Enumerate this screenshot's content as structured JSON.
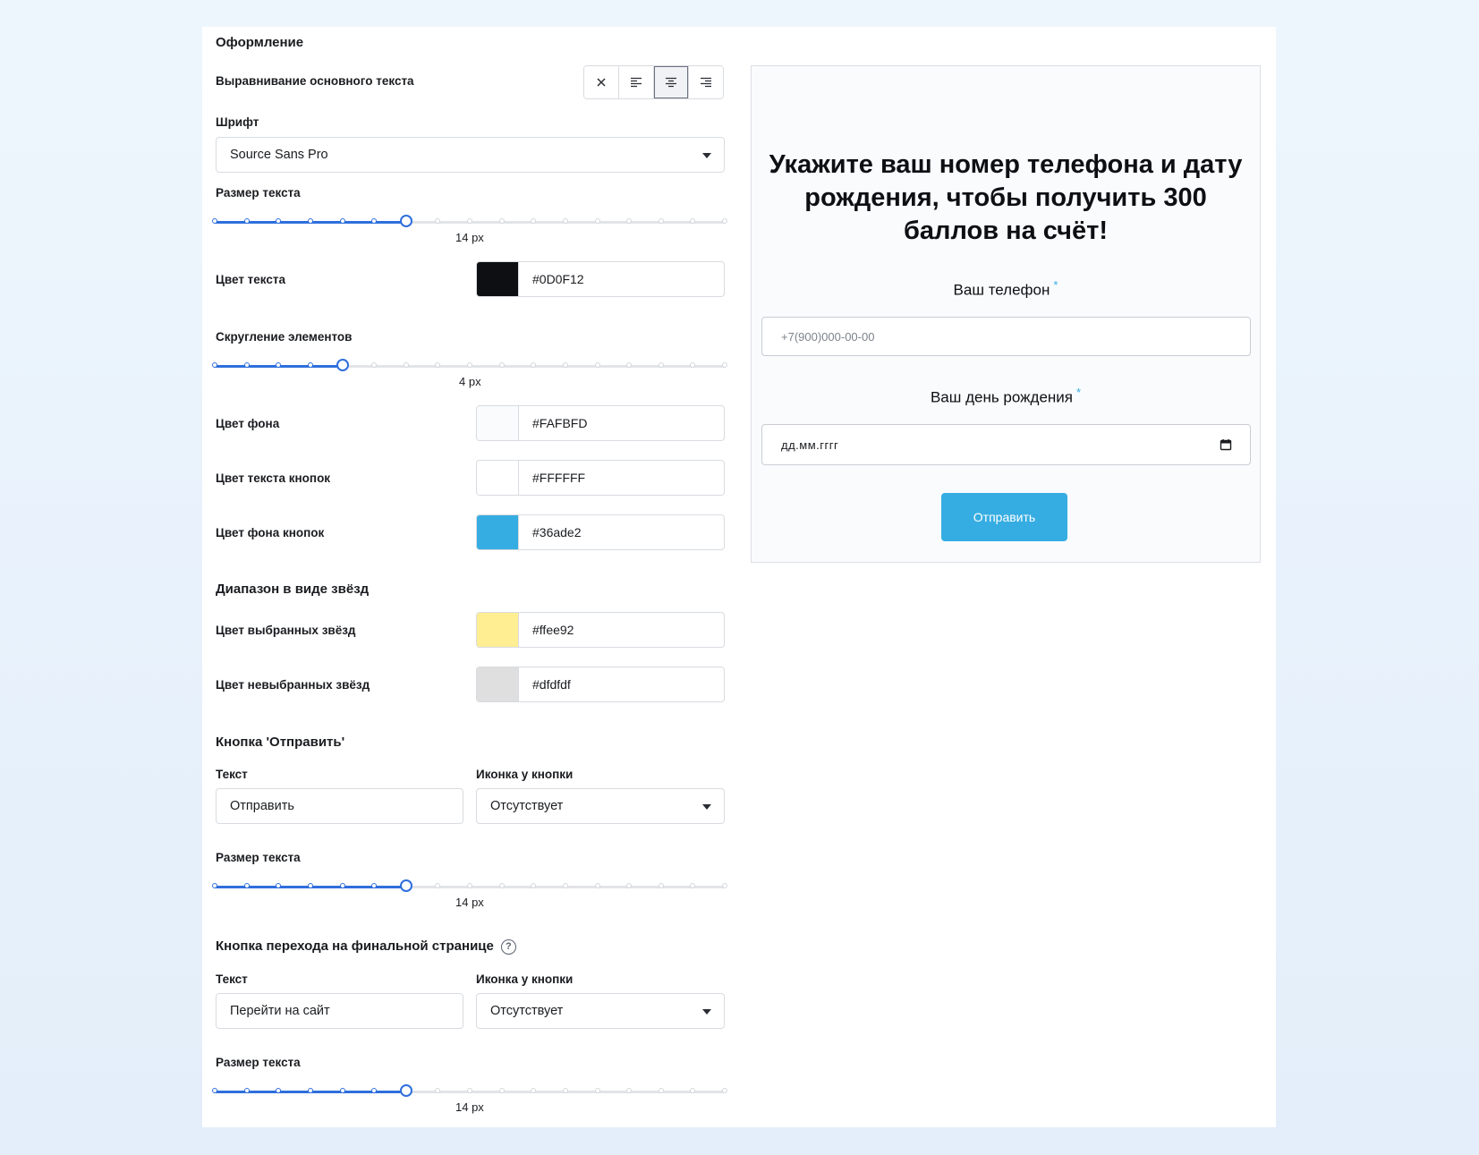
{
  "design": {
    "section_title": "Оформление",
    "alignment_label": "Выравнивание основного текста",
    "font_label": "Шрифт",
    "font_value": "Source Sans Pro",
    "text_size_label": "Размер текста",
    "text_size_value": "14 px",
    "text_size_level": 6,
    "text_color_label": "Цвет текста",
    "text_color_value": "#0D0F12",
    "radius_label": "Скругление элементов",
    "radius_value": "4 px",
    "radius_level": 4,
    "bg_color_label": "Цвет фона",
    "bg_color_value": "#FAFBFD",
    "btn_text_color_label": "Цвет текста кнопок",
    "btn_text_color_value": "#FFFFFF",
    "btn_bg_color_label": "Цвет фона кнопок",
    "btn_bg_color_value": "#36ade2"
  },
  "stars": {
    "section_title": "Диапазон в виде звёзд",
    "selected_label": "Цвет выбранных звёзд",
    "selected_value": "#ffee92",
    "unselected_label": "Цвет невыбранных звёзд",
    "unselected_value": "#dfdfdf"
  },
  "submit_button": {
    "section_title": "Кнопка 'Отправить'",
    "text_label": "Текст",
    "text_value": "Отправить",
    "icon_label": "Иконка у кнопки",
    "icon_value": "Отсутствует",
    "size_label": "Размер текста",
    "size_value": "14 px",
    "size_level": 6
  },
  "final_button": {
    "section_title": "Кнопка перехода на финальной странице",
    "help": "?",
    "text_label": "Текст",
    "text_value": "Перейти на сайт",
    "icon_label": "Иконка у кнопки",
    "icon_value": "Отсутствует",
    "size_label": "Размер текста",
    "size_value": "14 px",
    "size_level": 6
  },
  "slider_steps": 16,
  "colors": {
    "accent": "#2f6fdc",
    "text": "#0D0F12",
    "background": "#FAFBFD",
    "button_bg": "#36ade2",
    "star_selected": "#ffee92",
    "star_unselected": "#dfdfdf"
  },
  "preview": {
    "title": "Укажите ваш номер телефона и дату рождения, чтобы получить 300 баллов на счёт!",
    "phone_label": "Ваш телефон",
    "phone_placeholder": "+7(900)000-00-00",
    "birthday_label": "Ваш день рождения",
    "birthday_placeholder": "дд.мм.гггг",
    "required_mark": "*",
    "submit_label": "Отправить"
  }
}
